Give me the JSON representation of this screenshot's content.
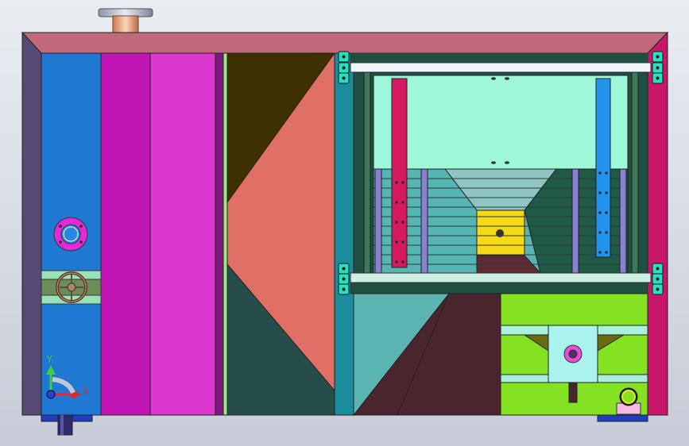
{
  "viewport": {
    "background": "#d4d8e2",
    "axis_triad": {
      "x_label": "X",
      "y_label": "Y",
      "x_color": "#e5262c",
      "y_color": "#3ccf3a",
      "z_color": "#2b3ee0"
    }
  },
  "palette": {
    "frame_top": "#c0697a",
    "frame_left": "#564a74",
    "blue_panel": "#1f78d1",
    "magenta_panel": "#c215b6",
    "pink_panel": "#dc38cf",
    "salmon": "#e07066",
    "olive": "#3f3000",
    "dark_teal": "#274d4b",
    "cyan_light": "#9ef7d9",
    "yellow": "#f5d816",
    "lime": "#84e222",
    "teal": "#5cb4b1",
    "wine": "#4b252d",
    "crimson": "#d51a62"
  },
  "icons": [
    "flange-port-icon",
    "handwheel-valve-icon",
    "lifting-eye-icon",
    "pipe-outlet-icon",
    "axis-triad-icon"
  ]
}
